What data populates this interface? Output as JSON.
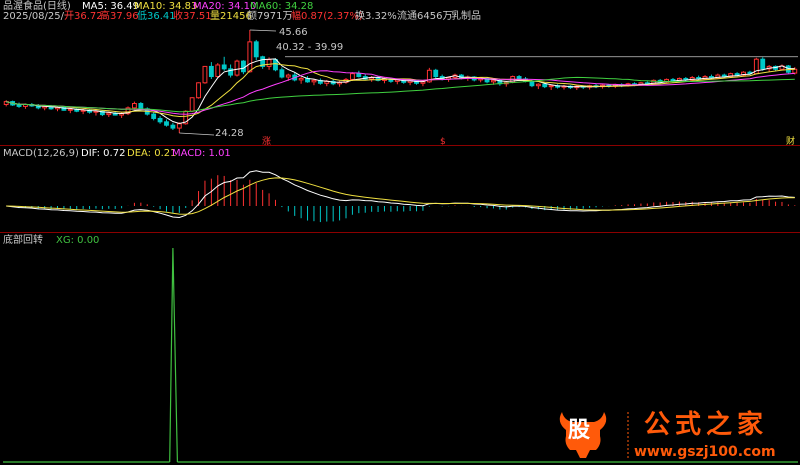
{
  "colors": {
    "up": "#ff3232",
    "down": "#00c8c8",
    "ma5": "#ffffff",
    "ma10": "#f0e040",
    "ma20": "#ff40ff",
    "ma60": "#40d040",
    "dif": "#ffffff",
    "dea": "#f0e040",
    "xg": "#40c040",
    "text": "#c8c8c8",
    "sep": "#8b0000",
    "logo": "#ff5a0a"
  },
  "header": {
    "title": "品渥食品(日线)",
    "date": "2025/08/25/一",
    "ma5": "MA5: 36.49",
    "ma10": "MA10: 34.83",
    "ma20": "MA20: 34.10",
    "ma60": "MA60: 34.28"
  },
  "quote": {
    "open": "开36.72",
    "high": "高37.96",
    "low": "低36.41",
    "close": "收37.51",
    "volume": "量21456",
    "amount": "额7971万",
    "change": "幅0.87(2.37%)",
    "turnover": "换3.32%",
    "float_mv": "流通6456万",
    "industry": "乳制品"
  },
  "annotations": {
    "high1": "45.66",
    "range": "40.32 - 39.99",
    "low1": "24.28",
    "zhang": "涨",
    "mark2": "$",
    "caibao": "财"
  },
  "macd_header": {
    "name": "MACD(12,26,9)",
    "dif": "DIF: 0.72",
    "dea": "DEA: 0.21",
    "macd": "MACD: 1.01"
  },
  "bottom_header": {
    "name": "底部回转",
    "xg": "XG: 0.00"
  },
  "logo": {
    "icon_text": "股",
    "title": "公式之家",
    "url": "www.gszj100.com"
  },
  "chart_data": [
    {
      "type": "candlestick",
      "title": "品渥食品(日线)",
      "ylim": [
        24.28,
        45.66
      ],
      "annotations": [
        "45.66",
        "40.32 - 39.99",
        "24.28"
      ],
      "candles": [
        [
          30.2,
          31.1,
          29.8,
          30.8
        ],
        [
          30.8,
          31.0,
          29.9,
          30.1
        ],
        [
          30.1,
          30.6,
          29.5,
          29.8
        ],
        [
          29.8,
          30.4,
          29.3,
          30.2
        ],
        [
          30.2,
          30.5,
          29.7,
          29.9
        ],
        [
          29.9,
          30.3,
          29.2,
          29.5
        ],
        [
          29.5,
          30.0,
          29.0,
          29.8
        ],
        [
          29.8,
          30.1,
          29.1,
          29.3
        ],
        [
          29.3,
          29.9,
          28.8,
          29.6
        ],
        [
          29.6,
          29.8,
          28.9,
          29.0
        ],
        [
          29.0,
          29.5,
          28.4,
          29.2
        ],
        [
          29.2,
          29.4,
          28.6,
          28.8
        ],
        [
          28.8,
          29.3,
          28.2,
          29.0
        ],
        [
          29.0,
          29.2,
          28.3,
          28.6
        ],
        [
          28.6,
          29.0,
          27.9,
          28.8
        ],
        [
          28.8,
          29.0,
          27.8,
          28.1
        ],
        [
          28.1,
          28.7,
          27.6,
          28.4
        ],
        [
          28.4,
          28.8,
          27.9,
          28.0
        ],
        [
          28.0,
          28.6,
          27.4,
          28.3
        ],
        [
          28.3,
          29.8,
          28.0,
          29.5
        ],
        [
          29.5,
          30.8,
          29.1,
          30.4
        ],
        [
          30.4,
          30.7,
          29.0,
          29.3
        ],
        [
          29.3,
          29.6,
          27.9,
          28.2
        ],
        [
          28.2,
          28.6,
          26.9,
          27.3
        ],
        [
          27.3,
          27.8,
          26.2,
          26.6
        ],
        [
          26.6,
          27.1,
          25.6,
          25.9
        ],
        [
          25.9,
          26.4,
          24.9,
          25.3
        ],
        [
          25.3,
          26.5,
          24.28,
          26.2
        ],
        [
          26.2,
          29.0,
          26.0,
          28.8
        ],
        [
          28.8,
          31.7,
          28.6,
          31.6
        ],
        [
          31.6,
          34.8,
          31.4,
          34.7
        ],
        [
          34.7,
          38.2,
          34.5,
          38.1
        ],
        [
          38.1,
          39.0,
          35.5,
          36.0
        ],
        [
          36.0,
          38.8,
          35.7,
          38.4
        ],
        [
          38.4,
          40.1,
          37.2,
          37.6
        ],
        [
          37.6,
          38.5,
          35.8,
          36.3
        ],
        [
          36.3,
          39.5,
          36.0,
          39.2
        ],
        [
          39.2,
          39.4,
          36.5,
          37.0
        ],
        [
          37.0,
          45.66,
          36.8,
          43.2
        ],
        [
          43.2,
          43.6,
          39.4,
          40.1
        ],
        [
          40.1,
          40.32,
          37.6,
          38.1
        ],
        [
          38.1,
          39.99,
          37.4,
          39.5
        ],
        [
          39.5,
          39.8,
          37.1,
          37.4
        ],
        [
          37.4,
          37.9,
          35.6,
          35.9
        ],
        [
          35.9,
          36.6,
          35.1,
          36.3
        ],
        [
          36.3,
          36.8,
          35.0,
          35.3
        ],
        [
          35.3,
          35.9,
          34.5,
          35.6
        ],
        [
          35.6,
          36.1,
          34.7,
          34.9
        ],
        [
          34.9,
          35.5,
          34.2,
          35.2
        ],
        [
          35.2,
          35.6,
          34.3,
          34.6
        ],
        [
          34.6,
          35.3,
          34.0,
          35.0
        ],
        [
          35.0,
          35.4,
          34.2,
          34.5
        ],
        [
          34.5,
          35.1,
          33.9,
          34.8
        ],
        [
          34.8,
          35.7,
          34.5,
          35.4
        ],
        [
          35.4,
          36.9,
          35.1,
          36.6
        ],
        [
          36.6,
          37.2,
          35.8,
          36.0
        ],
        [
          36.0,
          36.5,
          35.2,
          35.5
        ],
        [
          35.5,
          36.1,
          34.9,
          35.8
        ],
        [
          35.8,
          36.0,
          35.0,
          35.2
        ],
        [
          35.2,
          35.8,
          34.6,
          35.5
        ],
        [
          35.5,
          35.8,
          34.7,
          35.0
        ],
        [
          35.0,
          35.6,
          34.4,
          35.3
        ],
        [
          35.3,
          35.5,
          34.5,
          34.8
        ],
        [
          34.8,
          35.4,
          34.2,
          35.1
        ],
        [
          35.1,
          35.3,
          34.3,
          34.6
        ],
        [
          34.6,
          35.2,
          34.0,
          34.9
        ],
        [
          34.9,
          37.8,
          34.7,
          37.3
        ],
        [
          37.3,
          37.6,
          35.7,
          36.0
        ],
        [
          36.0,
          36.4,
          35.2,
          35.5
        ],
        [
          35.5,
          36.0,
          34.9,
          35.8
        ],
        [
          35.8,
          36.6,
          35.5,
          36.3
        ],
        [
          36.3,
          36.5,
          35.4,
          35.7
        ],
        [
          35.7,
          36.2,
          35.1,
          35.9
        ],
        [
          35.9,
          36.1,
          35.0,
          35.3
        ],
        [
          35.3,
          35.9,
          34.8,
          35.6
        ],
        [
          35.6,
          35.8,
          34.6,
          34.9
        ],
        [
          34.9,
          35.5,
          34.3,
          35.2
        ],
        [
          35.2,
          35.4,
          34.1,
          34.5
        ],
        [
          34.5,
          35.0,
          33.9,
          34.8
        ],
        [
          34.8,
          36.2,
          34.6,
          36.0
        ],
        [
          36.0,
          36.3,
          35.2,
          35.5
        ],
        [
          35.5,
          35.9,
          34.8,
          35.0
        ],
        [
          35.0,
          35.3,
          33.8,
          34.1
        ],
        [
          34.1,
          34.6,
          33.4,
          34.4
        ],
        [
          34.4,
          34.7,
          33.6,
          33.9
        ],
        [
          33.9,
          34.3,
          33.2,
          34.1
        ],
        [
          34.1,
          34.4,
          33.5,
          33.8
        ],
        [
          33.8,
          34.3,
          33.3,
          34.0
        ],
        [
          34.0,
          34.2,
          33.4,
          33.7
        ],
        [
          33.7,
          34.2,
          33.2,
          34.0
        ],
        [
          34.0,
          34.2,
          33.4,
          33.8
        ],
        [
          33.8,
          34.3,
          33.3,
          34.1
        ],
        [
          34.1,
          34.5,
          33.6,
          33.9
        ],
        [
          33.9,
          34.4,
          33.5,
          34.2
        ],
        [
          34.2,
          34.4,
          33.7,
          34.0
        ],
        [
          34.0,
          34.5,
          33.6,
          34.3
        ],
        [
          34.3,
          34.6,
          33.8,
          34.1
        ],
        [
          34.1,
          34.7,
          33.9,
          34.5
        ],
        [
          34.5,
          34.8,
          34.0,
          34.3
        ],
        [
          34.3,
          34.9,
          34.1,
          34.7
        ],
        [
          34.7,
          35.0,
          34.2,
          34.5
        ],
        [
          34.5,
          35.4,
          34.3,
          35.2
        ],
        [
          35.2,
          35.5,
          34.6,
          34.9
        ],
        [
          34.9,
          35.6,
          34.7,
          35.4
        ],
        [
          35.4,
          35.7,
          34.8,
          35.1
        ],
        [
          35.1,
          35.8,
          34.9,
          35.6
        ],
        [
          35.6,
          35.9,
          35.0,
          35.3
        ],
        [
          35.3,
          36.1,
          35.1,
          35.8
        ],
        [
          35.8,
          36.2,
          35.2,
          35.5
        ],
        [
          35.5,
          36.3,
          35.3,
          36.0
        ],
        [
          36.0,
          36.4,
          35.4,
          35.7
        ],
        [
          35.7,
          36.6,
          35.5,
          36.3
        ],
        [
          36.3,
          36.6,
          35.8,
          36.0
        ],
        [
          36.0,
          36.8,
          35.8,
          36.6
        ],
        [
          36.6,
          36.9,
          36.1,
          36.3
        ],
        [
          36.3,
          37.1,
          36.1,
          36.9
        ],
        [
          36.9,
          37.2,
          36.4,
          36.6
        ],
        [
          36.6,
          39.9,
          36.5,
          39.6
        ],
        [
          39.6,
          40.0,
          37.2,
          37.6
        ],
        [
          37.6,
          38.4,
          37.0,
          38.1
        ],
        [
          38.1,
          38.3,
          37.2,
          37.5
        ],
        [
          37.5,
          38.5,
          37.3,
          38.2
        ],
        [
          38.2,
          38.4,
          36.6,
          36.9
        ],
        [
          36.72,
          37.96,
          36.41,
          37.51
        ]
      ]
    },
    {
      "type": "bar+line",
      "title": "MACD(12,26,9)",
      "dif_last": 0.72,
      "dea_last": 0.21,
      "macd_last": 1.01,
      "series": [
        {
          "name": "DIF"
        },
        {
          "name": "DEA"
        },
        {
          "name": "MACD"
        }
      ]
    },
    {
      "type": "line",
      "title": "底部回转",
      "series": [
        {
          "name": "XG",
          "last": 0.0,
          "signal_index": 27,
          "signal_value": 1
        }
      ]
    }
  ]
}
